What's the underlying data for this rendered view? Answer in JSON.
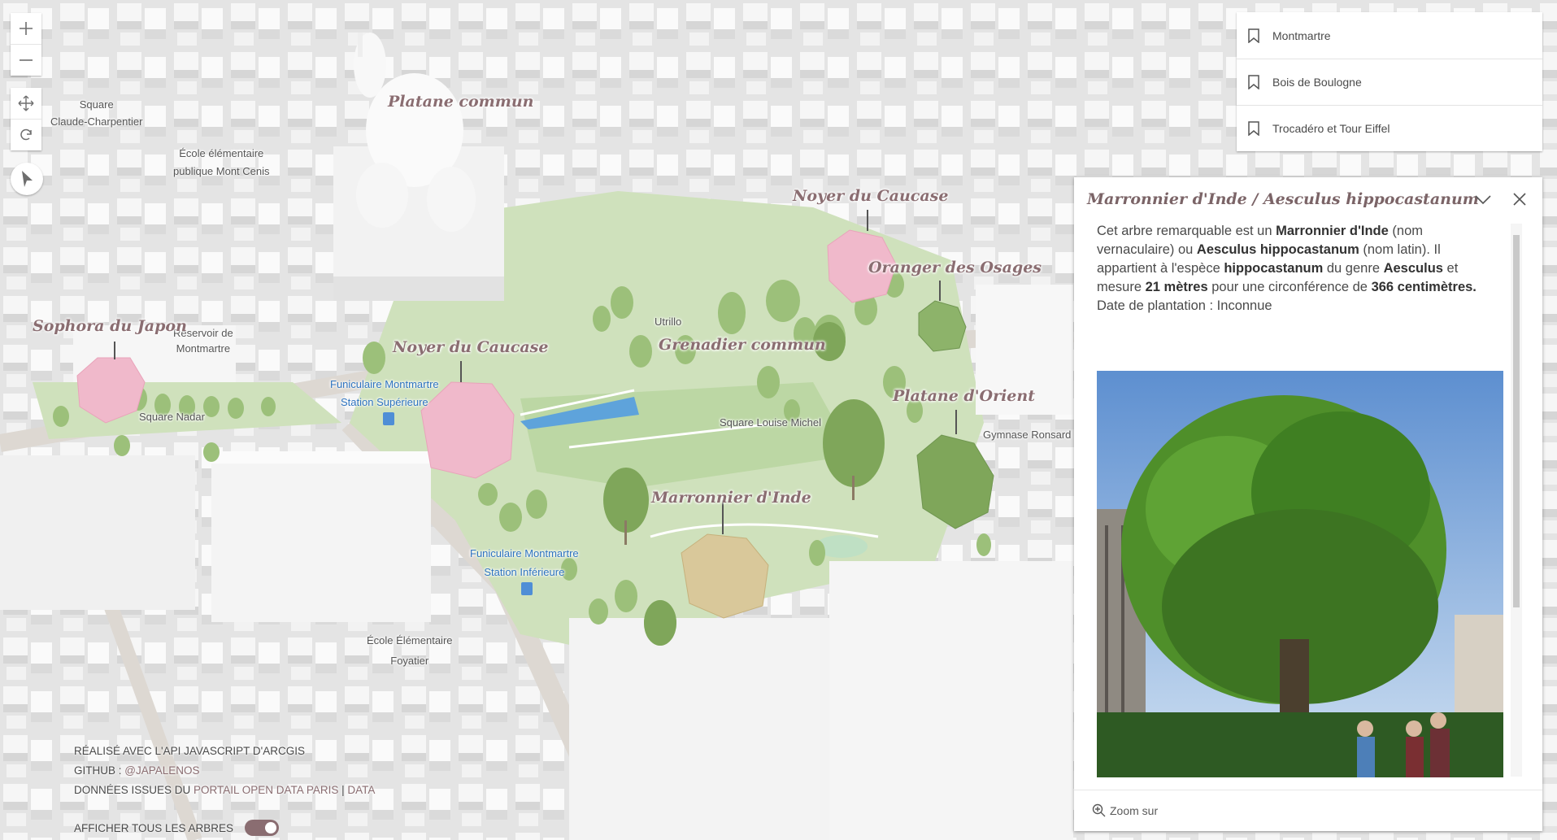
{
  "map": {
    "place_labels": [
      {
        "id": "square-claude-charpentier",
        "text": "Square\nClaude-Charpentier"
      },
      {
        "id": "ecole-mont-cenis",
        "text": "École élémentaire\npublique Mont Cenis"
      },
      {
        "id": "reservoir-montmartre",
        "text": "Réservoir de\nMontmartre"
      },
      {
        "id": "square-nadar",
        "text": "Square Nadar"
      },
      {
        "id": "funiculaire-superieure",
        "text": "Funiculaire Montmartre\nStation Supérieure"
      },
      {
        "id": "utrillo",
        "text": "Utrillo"
      },
      {
        "id": "square-louise-michel",
        "text": "Square Louise Michel"
      },
      {
        "id": "gymnase-ronsard",
        "text": "Gymnase Ronsard"
      },
      {
        "id": "funiculaire-inferieure",
        "text": "Funiculaire Montmartre\nStation Inférieure"
      },
      {
        "id": "ecole-foyatier",
        "text": "École Élémentaire\nFoyatier"
      }
    ],
    "tree_labels": [
      {
        "id": "platane-commun",
        "text": "Platane commun"
      },
      {
        "id": "noyer-caucase-1",
        "text": "Noyer du Caucase"
      },
      {
        "id": "oranger-osages",
        "text": "Oranger des Osages"
      },
      {
        "id": "sophora-japon",
        "text": "Sophora du Japon"
      },
      {
        "id": "noyer-caucase-2",
        "text": "Noyer du Caucase"
      },
      {
        "id": "grenadier-commun",
        "text": "Grenadier commun"
      },
      {
        "id": "platane-orient",
        "text": "Platane d'Orient"
      },
      {
        "id": "marronnier-inde",
        "text": "Marronnier d'Inde"
      }
    ],
    "colors": {
      "highlight_tree": "#f0b9cb",
      "selected_tree": "#d9c89a",
      "remarkable_green": "#7fa65a",
      "accent": "#8a6d71"
    }
  },
  "controls": {
    "zoom_in_icon": "plus-icon",
    "zoom_out_icon": "minus-icon",
    "pan_icon": "move-icon",
    "rotate_icon": "rotate-icon",
    "compass_icon": "compass-icon"
  },
  "bookmarks": [
    {
      "label": "Montmartre"
    },
    {
      "label": "Bois de Boulogne"
    },
    {
      "label": "Trocadéro et Tour Eiffel"
    }
  ],
  "popup": {
    "title": "Marronnier d'Inde / Aesculus hippocastanum",
    "body": {
      "p1": "Cet arbre remarquable est un ",
      "common_name": "Marronnier d'Inde",
      "p2": " (nom vernaculaire) ou ",
      "latin_name": "Aesculus hippocastanum",
      "p3": " (nom latin). Il appartient à l'espèce ",
      "species": "hippocastanum",
      "p4": " du genre ",
      "genus": "Aesculus",
      "p5": " et mesure ",
      "height": "21 mètres",
      "p6": " pour une circonférence de ",
      "circumference": "366 centimètres.",
      "planting": "Date de plantation : Inconnue"
    },
    "footer_action": "Zoom sur"
  },
  "credits": {
    "line1": "RÉALISÉ AVEC L'API JAVASCRIPT D'ARCGIS",
    "line2_prefix": "GITHUB : ",
    "line2_link": "@JAPALENOS",
    "line3_prefix": "DONNÉES ISSUES DU ",
    "line3_link1": "PORTAIL OPEN DATA PARIS",
    "line3_sep": " | ",
    "line3_link2": "DATA",
    "toggle_label": "AFFICHER TOUS LES ARBRES",
    "toggle_on": true
  }
}
